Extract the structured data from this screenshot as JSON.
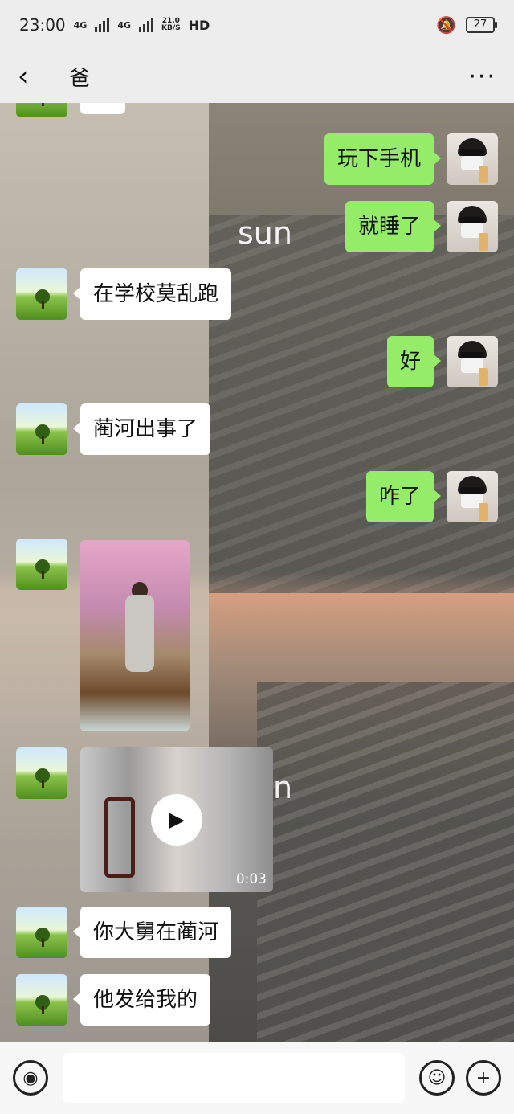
{
  "status": {
    "time": "23:00",
    "net_left": "4G",
    "net_right": "4G",
    "speed_value": "21.0",
    "speed_unit": "KB/S",
    "hd": "HD",
    "battery": "27"
  },
  "header": {
    "title": "爸"
  },
  "wallpaper": {
    "text1": "sun",
    "text2": "n"
  },
  "messages": {
    "m1": "玩下手机",
    "m2": "就睡了",
    "m3": "在学校莫乱跑",
    "m4": "好",
    "m5": "蔺河出事了",
    "m6": "咋了",
    "video_duration": "0:03",
    "m7": "你大舅在蔺河",
    "m8": "他发给我的"
  },
  "icons": {
    "voice": "voice-icon",
    "emoji": "emoji-icon",
    "plus": "plus-icon"
  }
}
